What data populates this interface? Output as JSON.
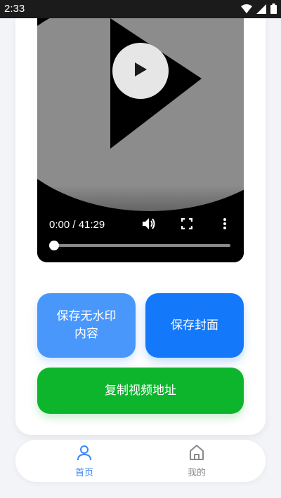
{
  "status_bar": {
    "time": "2:33",
    "icons": [
      "wifi-icon",
      "signal-icon",
      "battery-icon"
    ]
  },
  "video": {
    "time_display": "0:00 / 41:29",
    "progress": 0.0,
    "icons": [
      "play-icon",
      "volume-icon",
      "fullscreen-icon",
      "more-vert-icon"
    ]
  },
  "actions": {
    "save_content_label": "保存无水印内容",
    "save_cover_label": "保存封面",
    "copy_url_label": "复制视频地址"
  },
  "colors": {
    "save_content_bg": "#4a97fb",
    "save_cover_bg": "#1478fb",
    "copy_url_bg": "#0db52c",
    "tab_active": "#3a86f5",
    "tab_inactive": "#8a8a8a"
  },
  "tabbar": {
    "items": [
      {
        "label": "首页",
        "icon": "user-icon",
        "active": true
      },
      {
        "label": "我的",
        "icon": "home-icon",
        "active": false
      }
    ]
  }
}
